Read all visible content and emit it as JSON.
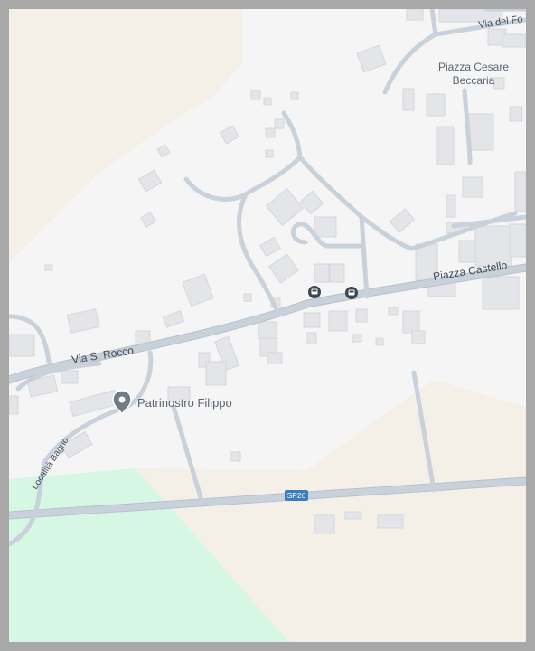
{
  "map": {
    "colors": {
      "background": "#f5f5f6",
      "building": "#e4e5e8",
      "building_stroke": "#d5d7db",
      "road": "#c9d1db",
      "road_casing": "#b6c1cd",
      "land_beige": "#f4f0e7",
      "park_green": "#d6f7e4",
      "label": "#5b6470",
      "road_label": "#3f4a56",
      "shield_bg": "#3d7bbf",
      "pin": "#6f7d88"
    },
    "labels": {
      "place_name_line1": "Piazza Cesare",
      "place_name_line2": "Beccaria",
      "road_via_del_fo": "Via del Fo",
      "road_piazza_castello": "Piazza Castello",
      "road_via_s_rocco": "Via S. Rocco",
      "road_localita_bagno": "Località Bagno",
      "route_shield": "SP26",
      "poi_name": "Patrinostro Filippo"
    },
    "icons": {
      "poi_marker": "map-pin-icon",
      "bus_stop_1": "bus-stop-icon",
      "bus_stop_2": "bus-stop-icon"
    }
  }
}
